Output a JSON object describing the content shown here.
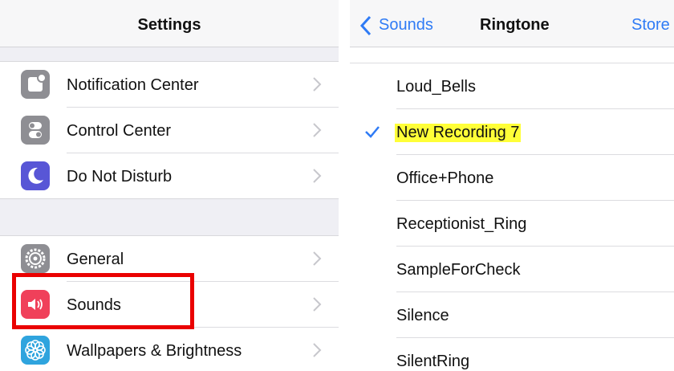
{
  "settings": {
    "title": "Settings",
    "groups": [
      [
        {
          "label": "Notification Center",
          "icon": "notification-center-icon",
          "color": "#8e8e93"
        },
        {
          "label": "Control Center",
          "icon": "control-center-icon",
          "color": "#8e8e93"
        },
        {
          "label": "Do Not Disturb",
          "icon": "moon-icon",
          "color": "#5856d6"
        }
      ],
      [
        {
          "label": "General",
          "icon": "gear-icon",
          "color": "#8e8e93"
        },
        {
          "label": "Sounds",
          "icon": "speaker-icon",
          "color": "#f0405a"
        },
        {
          "label": "Wallpapers & Brightness",
          "icon": "wallpaper-flower-icon",
          "color": "#2fa4de"
        }
      ]
    ],
    "highlighted_item": "Sounds",
    "highlight_color": "#ea0000"
  },
  "ringtone": {
    "back_label": "Sounds",
    "title": "Ringtone",
    "store_label": "Store",
    "items": [
      "Loud_Bells",
      "New Recording 7",
      "Office+Phone",
      "Receptionist_Ring",
      "SampleForCheck",
      "Silence",
      "SilentRing"
    ],
    "selected": "New Recording 7",
    "selected_highlight_color": "#ffff38",
    "accent_color": "#2f7bf5"
  }
}
